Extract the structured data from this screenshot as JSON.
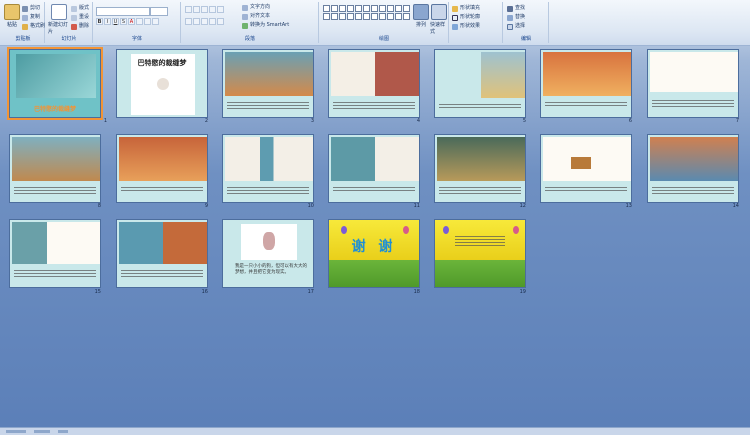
{
  "ribbon": {
    "groups": [
      {
        "label": "剪贴板",
        "items": [
          "剪切",
          "复制",
          "格式刷",
          "粘贴"
        ]
      },
      {
        "label": "幻灯片",
        "items": [
          "新建幻灯片",
          "版式",
          "重设",
          "删除"
        ]
      },
      {
        "label": "字体",
        "items": [
          "B",
          "I",
          "U",
          "S",
          "A"
        ]
      },
      {
        "label": "段落",
        "items": [
          "文字方向",
          "对齐文本",
          "转换为 SmartArt"
        ]
      },
      {
        "label": "绘图",
        "items": [
          "排列",
          "快速样式",
          "形状填充",
          "形状轮廓",
          "形状效果"
        ]
      },
      {
        "label": "编辑",
        "items": [
          "查找",
          "替换",
          "选择"
        ]
      }
    ]
  },
  "slides": [
    {
      "num": "1",
      "title": "巴特愍的裁缝梦",
      "selected": true
    },
    {
      "num": "2",
      "title": "巴特愍的裁缝梦"
    },
    {
      "num": "3"
    },
    {
      "num": "4"
    },
    {
      "num": "5"
    },
    {
      "num": "6"
    },
    {
      "num": "7"
    },
    {
      "num": "8"
    },
    {
      "num": "9"
    },
    {
      "num": "10"
    },
    {
      "num": "11"
    },
    {
      "num": "12"
    },
    {
      "num": "13"
    },
    {
      "num": "14"
    },
    {
      "num": "15"
    },
    {
      "num": "16"
    },
    {
      "num": "17",
      "caption": "我是一只小小的狗，但可以有大大的梦想，并且把它变为现实。"
    },
    {
      "num": "18",
      "title": "谢 谢"
    },
    {
      "num": "19"
    }
  ],
  "colors": {
    "accent": "#f29436",
    "teal": "#6fc2c7",
    "slide_bg": "#c9e8ea"
  }
}
